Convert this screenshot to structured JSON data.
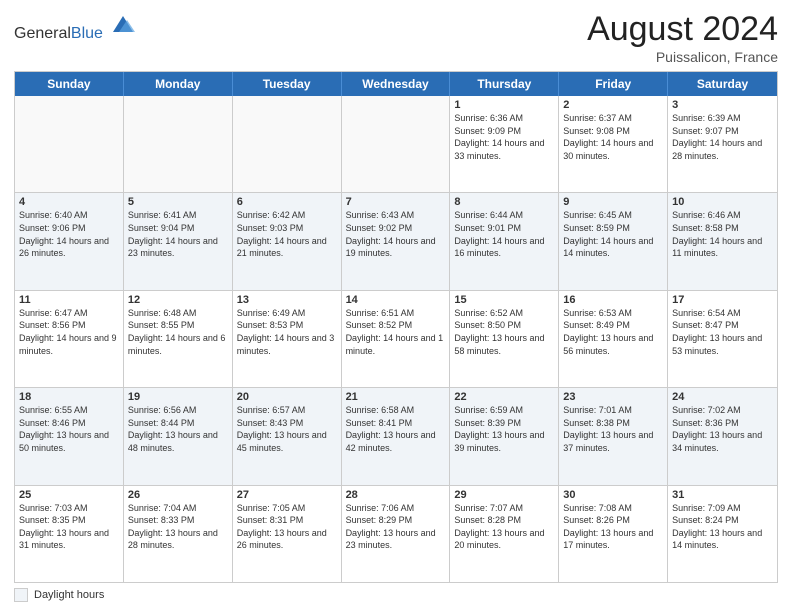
{
  "header": {
    "logo_general": "General",
    "logo_blue": "Blue",
    "month_year": "August 2024",
    "location": "Puissalicon, France"
  },
  "legend": {
    "label": "Daylight hours"
  },
  "days_of_week": [
    "Sunday",
    "Monday",
    "Tuesday",
    "Wednesday",
    "Thursday",
    "Friday",
    "Saturday"
  ],
  "weeks": [
    {
      "row_alt": false,
      "cells": [
        {
          "day": "",
          "sunrise": "",
          "sunset": "",
          "daylight": ""
        },
        {
          "day": "",
          "sunrise": "",
          "sunset": "",
          "daylight": ""
        },
        {
          "day": "",
          "sunrise": "",
          "sunset": "",
          "daylight": ""
        },
        {
          "day": "",
          "sunrise": "",
          "sunset": "",
          "daylight": ""
        },
        {
          "day": "1",
          "sunrise": "Sunrise: 6:36 AM",
          "sunset": "Sunset: 9:09 PM",
          "daylight": "Daylight: 14 hours and 33 minutes."
        },
        {
          "day": "2",
          "sunrise": "Sunrise: 6:37 AM",
          "sunset": "Sunset: 9:08 PM",
          "daylight": "Daylight: 14 hours and 30 minutes."
        },
        {
          "day": "3",
          "sunrise": "Sunrise: 6:39 AM",
          "sunset": "Sunset: 9:07 PM",
          "daylight": "Daylight: 14 hours and 28 minutes."
        }
      ]
    },
    {
      "row_alt": true,
      "cells": [
        {
          "day": "4",
          "sunrise": "Sunrise: 6:40 AM",
          "sunset": "Sunset: 9:06 PM",
          "daylight": "Daylight: 14 hours and 26 minutes."
        },
        {
          "day": "5",
          "sunrise": "Sunrise: 6:41 AM",
          "sunset": "Sunset: 9:04 PM",
          "daylight": "Daylight: 14 hours and 23 minutes."
        },
        {
          "day": "6",
          "sunrise": "Sunrise: 6:42 AM",
          "sunset": "Sunset: 9:03 PM",
          "daylight": "Daylight: 14 hours and 21 minutes."
        },
        {
          "day": "7",
          "sunrise": "Sunrise: 6:43 AM",
          "sunset": "Sunset: 9:02 PM",
          "daylight": "Daylight: 14 hours and 19 minutes."
        },
        {
          "day": "8",
          "sunrise": "Sunrise: 6:44 AM",
          "sunset": "Sunset: 9:01 PM",
          "daylight": "Daylight: 14 hours and 16 minutes."
        },
        {
          "day": "9",
          "sunrise": "Sunrise: 6:45 AM",
          "sunset": "Sunset: 8:59 PM",
          "daylight": "Daylight: 14 hours and 14 minutes."
        },
        {
          "day": "10",
          "sunrise": "Sunrise: 6:46 AM",
          "sunset": "Sunset: 8:58 PM",
          "daylight": "Daylight: 14 hours and 11 minutes."
        }
      ]
    },
    {
      "row_alt": false,
      "cells": [
        {
          "day": "11",
          "sunrise": "Sunrise: 6:47 AM",
          "sunset": "Sunset: 8:56 PM",
          "daylight": "Daylight: 14 hours and 9 minutes."
        },
        {
          "day": "12",
          "sunrise": "Sunrise: 6:48 AM",
          "sunset": "Sunset: 8:55 PM",
          "daylight": "Daylight: 14 hours and 6 minutes."
        },
        {
          "day": "13",
          "sunrise": "Sunrise: 6:49 AM",
          "sunset": "Sunset: 8:53 PM",
          "daylight": "Daylight: 14 hours and 3 minutes."
        },
        {
          "day": "14",
          "sunrise": "Sunrise: 6:51 AM",
          "sunset": "Sunset: 8:52 PM",
          "daylight": "Daylight: 14 hours and 1 minute."
        },
        {
          "day": "15",
          "sunrise": "Sunrise: 6:52 AM",
          "sunset": "Sunset: 8:50 PM",
          "daylight": "Daylight: 13 hours and 58 minutes."
        },
        {
          "day": "16",
          "sunrise": "Sunrise: 6:53 AM",
          "sunset": "Sunset: 8:49 PM",
          "daylight": "Daylight: 13 hours and 56 minutes."
        },
        {
          "day": "17",
          "sunrise": "Sunrise: 6:54 AM",
          "sunset": "Sunset: 8:47 PM",
          "daylight": "Daylight: 13 hours and 53 minutes."
        }
      ]
    },
    {
      "row_alt": true,
      "cells": [
        {
          "day": "18",
          "sunrise": "Sunrise: 6:55 AM",
          "sunset": "Sunset: 8:46 PM",
          "daylight": "Daylight: 13 hours and 50 minutes."
        },
        {
          "day": "19",
          "sunrise": "Sunrise: 6:56 AM",
          "sunset": "Sunset: 8:44 PM",
          "daylight": "Daylight: 13 hours and 48 minutes."
        },
        {
          "day": "20",
          "sunrise": "Sunrise: 6:57 AM",
          "sunset": "Sunset: 8:43 PM",
          "daylight": "Daylight: 13 hours and 45 minutes."
        },
        {
          "day": "21",
          "sunrise": "Sunrise: 6:58 AM",
          "sunset": "Sunset: 8:41 PM",
          "daylight": "Daylight: 13 hours and 42 minutes."
        },
        {
          "day": "22",
          "sunrise": "Sunrise: 6:59 AM",
          "sunset": "Sunset: 8:39 PM",
          "daylight": "Daylight: 13 hours and 39 minutes."
        },
        {
          "day": "23",
          "sunrise": "Sunrise: 7:01 AM",
          "sunset": "Sunset: 8:38 PM",
          "daylight": "Daylight: 13 hours and 37 minutes."
        },
        {
          "day": "24",
          "sunrise": "Sunrise: 7:02 AM",
          "sunset": "Sunset: 8:36 PM",
          "daylight": "Daylight: 13 hours and 34 minutes."
        }
      ]
    },
    {
      "row_alt": false,
      "cells": [
        {
          "day": "25",
          "sunrise": "Sunrise: 7:03 AM",
          "sunset": "Sunset: 8:35 PM",
          "daylight": "Daylight: 13 hours and 31 minutes."
        },
        {
          "day": "26",
          "sunrise": "Sunrise: 7:04 AM",
          "sunset": "Sunset: 8:33 PM",
          "daylight": "Daylight: 13 hours and 28 minutes."
        },
        {
          "day": "27",
          "sunrise": "Sunrise: 7:05 AM",
          "sunset": "Sunset: 8:31 PM",
          "daylight": "Daylight: 13 hours and 26 minutes."
        },
        {
          "day": "28",
          "sunrise": "Sunrise: 7:06 AM",
          "sunset": "Sunset: 8:29 PM",
          "daylight": "Daylight: 13 hours and 23 minutes."
        },
        {
          "day": "29",
          "sunrise": "Sunrise: 7:07 AM",
          "sunset": "Sunset: 8:28 PM",
          "daylight": "Daylight: 13 hours and 20 minutes."
        },
        {
          "day": "30",
          "sunrise": "Sunrise: 7:08 AM",
          "sunset": "Sunset: 8:26 PM",
          "daylight": "Daylight: 13 hours and 17 minutes."
        },
        {
          "day": "31",
          "sunrise": "Sunrise: 7:09 AM",
          "sunset": "Sunset: 8:24 PM",
          "daylight": "Daylight: 13 hours and 14 minutes."
        }
      ]
    }
  ]
}
